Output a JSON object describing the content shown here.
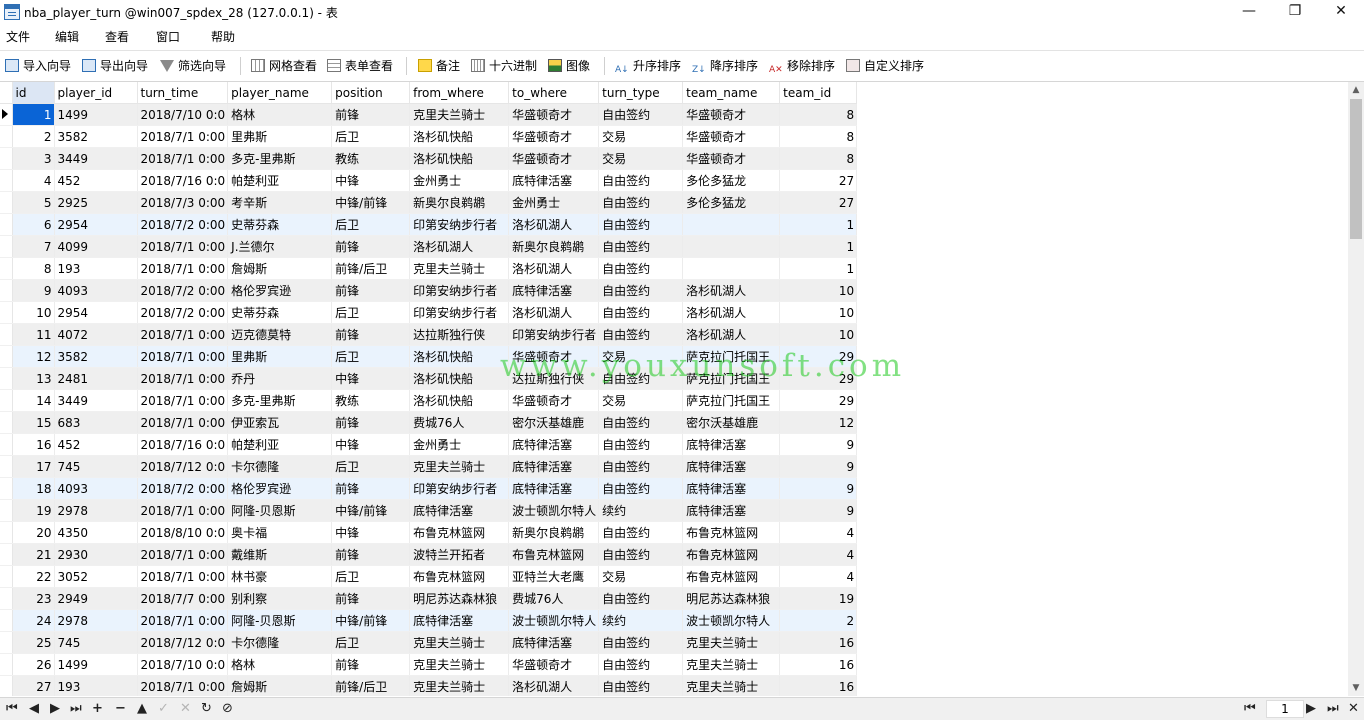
{
  "window": {
    "title": "nba_player_turn @win007_spdex_28 (127.0.0.1) - 表"
  },
  "window_controls": {
    "minimize": "—",
    "maximize": "❐",
    "close": "✕"
  },
  "menu": [
    "文件",
    "编辑",
    "查看",
    "窗口",
    "帮助"
  ],
  "toolbar": {
    "import": "导入向导",
    "export": "导出向导",
    "filter": "筛选向导",
    "grid_view": "网格查看",
    "form_view": "表单查看",
    "memo": "备注",
    "hex": "十六进制",
    "image": "图像",
    "sort_asc": "升序排序",
    "sort_desc": "降序排序",
    "sort_remove": "移除排序",
    "sort_custom": "自定义排序"
  },
  "columns": [
    "id",
    "player_id",
    "turn_time",
    "player_name",
    "position",
    "from_where",
    "to_where",
    "turn_type",
    "team_name",
    "team_id"
  ],
  "rows": [
    [
      "1",
      "1499",
      "2018/7/10 0:0",
      "格林",
      "前锋",
      "克里夫兰骑士",
      "华盛顿奇才",
      "自由签约",
      "华盛顿奇才",
      "8"
    ],
    [
      "2",
      "3582",
      "2018/7/1 0:00",
      "里弗斯",
      "后卫",
      "洛杉矶快船",
      "华盛顿奇才",
      "交易",
      "华盛顿奇才",
      "8"
    ],
    [
      "3",
      "3449",
      "2018/7/1 0:00",
      "多克-里弗斯",
      "教练",
      "洛杉矶快船",
      "华盛顿奇才",
      "交易",
      "华盛顿奇才",
      "8"
    ],
    [
      "4",
      "452",
      "2018/7/16 0:0",
      "帕楚利亚",
      "中锋",
      "金州勇士",
      "底特律活塞",
      "自由签约",
      "多伦多猛龙",
      "27"
    ],
    [
      "5",
      "2925",
      "2018/7/3 0:00",
      "考辛斯",
      "中锋/前锋",
      "新奥尔良鹈鹕",
      "金州勇士",
      "自由签约",
      "多伦多猛龙",
      "27"
    ],
    [
      "6",
      "2954",
      "2018/7/2 0:00",
      "史蒂芬森",
      "后卫",
      "印第安纳步行者",
      "洛杉矶湖人",
      "自由签约",
      "",
      "1"
    ],
    [
      "7",
      "4099",
      "2018/7/1 0:00",
      "J.兰德尔",
      "前锋",
      "洛杉矶湖人",
      "新奥尔良鹈鹕",
      "自由签约",
      "",
      "1"
    ],
    [
      "8",
      "193",
      "2018/7/1 0:00",
      "詹姆斯",
      "前锋/后卫",
      "克里夫兰骑士",
      "洛杉矶湖人",
      "自由签约",
      "",
      "1"
    ],
    [
      "9",
      "4093",
      "2018/7/2 0:00",
      "格伦罗宾逊",
      "前锋",
      "印第安纳步行者",
      "底特律活塞",
      "自由签约",
      "洛杉矶湖人",
      "10"
    ],
    [
      "10",
      "2954",
      "2018/7/2 0:00",
      "史蒂芬森",
      "后卫",
      "印第安纳步行者",
      "洛杉矶湖人",
      "自由签约",
      "洛杉矶湖人",
      "10"
    ],
    [
      "11",
      "4072",
      "2018/7/1 0:00",
      "迈克德莫特",
      "前锋",
      "达拉斯独行侠",
      "印第安纳步行者",
      "自由签约",
      "洛杉矶湖人",
      "10"
    ],
    [
      "12",
      "3582",
      "2018/7/1 0:00",
      "里弗斯",
      "后卫",
      "洛杉矶快船",
      "华盛顿奇才",
      "交易",
      "萨克拉门托国王",
      "29"
    ],
    [
      "13",
      "2481",
      "2018/7/1 0:00",
      "乔丹",
      "中锋",
      "洛杉矶快船",
      "达拉斯独行侠",
      "自由签约",
      "萨克拉门托国王",
      "29"
    ],
    [
      "14",
      "3449",
      "2018/7/1 0:00",
      "多克-里弗斯",
      "教练",
      "洛杉矶快船",
      "华盛顿奇才",
      "交易",
      "萨克拉门托国王",
      "29"
    ],
    [
      "15",
      "683",
      "2018/7/1 0:00",
      "伊亚索瓦",
      "前锋",
      "费城76人",
      "密尔沃基雄鹿",
      "自由签约",
      "密尔沃基雄鹿",
      "12"
    ],
    [
      "16",
      "452",
      "2018/7/16 0:0",
      "帕楚利亚",
      "中锋",
      "金州勇士",
      "底特律活塞",
      "自由签约",
      "底特律活塞",
      "9"
    ],
    [
      "17",
      "745",
      "2018/7/12 0:0",
      "卡尔德隆",
      "后卫",
      "克里夫兰骑士",
      "底特律活塞",
      "自由签约",
      "底特律活塞",
      "9"
    ],
    [
      "18",
      "4093",
      "2018/7/2 0:00",
      "格伦罗宾逊",
      "前锋",
      "印第安纳步行者",
      "底特律活塞",
      "自由签约",
      "底特律活塞",
      "9"
    ],
    [
      "19",
      "2978",
      "2018/7/1 0:00",
      "阿隆-贝恩斯",
      "中锋/前锋",
      "底特律活塞",
      "波士顿凯尔特人",
      "续约",
      "底特律活塞",
      "9"
    ],
    [
      "20",
      "4350",
      "2018/8/10 0:0",
      "奥卡福",
      "中锋",
      "布鲁克林篮网",
      "新奥尔良鹈鹕",
      "自由签约",
      "布鲁克林篮网",
      "4"
    ],
    [
      "21",
      "2930",
      "2018/7/1 0:00",
      "戴维斯",
      "前锋",
      "波特兰开拓者",
      "布鲁克林篮网",
      "自由签约",
      "布鲁克林篮网",
      "4"
    ],
    [
      "22",
      "3052",
      "2018/7/1 0:00",
      "林书豪",
      "后卫",
      "布鲁克林篮网",
      "亚特兰大老鹰",
      "交易",
      "布鲁克林篮网",
      "4"
    ],
    [
      "23",
      "2949",
      "2018/7/7 0:00",
      "别利察",
      "前锋",
      "明尼苏达森林狼",
      "费城76人",
      "自由签约",
      "明尼苏达森林狼",
      "19"
    ],
    [
      "24",
      "2978",
      "2018/7/1 0:00",
      "阿隆-贝恩斯",
      "中锋/前锋",
      "底特律活塞",
      "波士顿凯尔特人",
      "续约",
      "波士顿凯尔特人",
      "2"
    ],
    [
      "25",
      "745",
      "2018/7/12 0:0",
      "卡尔德隆",
      "后卫",
      "克里夫兰骑士",
      "底特律活塞",
      "自由签约",
      "克里夫兰骑士",
      "16"
    ],
    [
      "26",
      "1499",
      "2018/7/10 0:0",
      "格林",
      "前锋",
      "克里夫兰骑士",
      "华盛顿奇才",
      "自由签约",
      "克里夫兰骑士",
      "16"
    ],
    [
      "27",
      "193",
      "2018/7/1 0:00",
      "詹姆斯",
      "前锋/后卫",
      "克里夫兰骑士",
      "洛杉矶湖人",
      "自由签约",
      "克里夫兰骑士",
      "16"
    ]
  ],
  "highlighted_rows": [
    6,
    12,
    18,
    24
  ],
  "selected_row": 1,
  "watermark": "www.youxunsoft.com",
  "statusbar": {
    "page": "1"
  },
  "colors": {
    "selection": "#0a64d6",
    "alt_row": "#efefef",
    "highlight_row": "#eaf3fd",
    "watermark": "#1ec81e"
  }
}
